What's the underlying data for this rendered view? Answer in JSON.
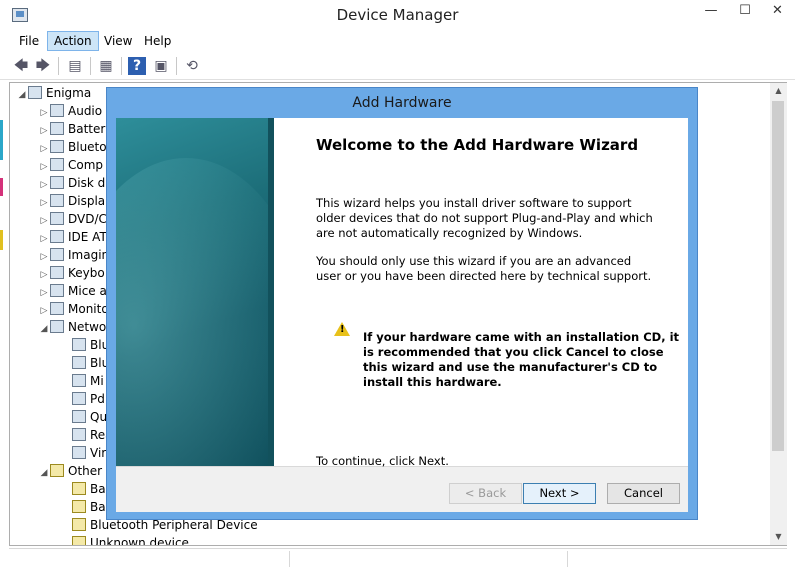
{
  "window": {
    "title": "Device Manager",
    "minimize_glyph": "—",
    "maximize_glyph": "☐",
    "close_glyph": "✕"
  },
  "menu": {
    "items": [
      {
        "label": "File"
      },
      {
        "label": "Action"
      },
      {
        "label": "View"
      },
      {
        "label": "Help"
      }
    ]
  },
  "toolbar": {
    "icons": [
      "back-arrow-icon",
      "forward-arrow-icon",
      "show-hide-console-icon",
      "properties-icon",
      "help-icon",
      "view-icon",
      "scan-hardware-icon"
    ],
    "glyphs": [
      "🡄",
      "🡆",
      "▤",
      "▦",
      "?",
      "▣",
      "⟲"
    ]
  },
  "tree": {
    "arrows": [
      "◢",
      "▷",
      "◢"
    ],
    "root": "Enigma",
    "categories": [
      {
        "label": "Audio"
      },
      {
        "label": "Batteri"
      },
      {
        "label": "Blueto"
      },
      {
        "label": "Comp"
      },
      {
        "label": "Disk dr"
      },
      {
        "label": "Displa"
      },
      {
        "label": "DVD/C"
      },
      {
        "label": "IDE AT"
      },
      {
        "label": "Imagin"
      },
      {
        "label": "Keybo"
      },
      {
        "label": "Mice a"
      },
      {
        "label": "Monito"
      },
      {
        "label": "Netwo"
      }
    ],
    "network_children": [
      {
        "label": "Blu"
      },
      {
        "label": "Blu"
      },
      {
        "label": "Mi"
      },
      {
        "label": "Pd"
      },
      {
        "label": "Qu"
      },
      {
        "label": "Rea"
      },
      {
        "label": "Vir"
      }
    ],
    "other_label": "Other",
    "other_children": [
      {
        "label": "Bas"
      },
      {
        "label": "Bas"
      },
      {
        "label": "Bluetooth Peripheral Device"
      },
      {
        "label": "Unknown device"
      }
    ]
  },
  "scroll": {
    "up": "▲",
    "down": "▼"
  },
  "dialog": {
    "title": "Add Hardware",
    "heading": "Welcome to the Add Hardware Wizard",
    "paragraph1": "This wizard helps you install driver software to support older devices that do not support Plug-and-Play and which are not automatically recognized by Windows.",
    "paragraph2": "You should only use this wizard if you are an advanced user or you have been directed here by technical support.",
    "warning_glyph": "!",
    "warning": "If your hardware came with an installation CD, it is recommended that you click Cancel to close this wizard and use the manufacturer's CD to install this hardware.",
    "continue": "To continue, click Next.",
    "buttons": {
      "back": "< Back",
      "next": "Next >",
      "cancel": "Cancel"
    }
  }
}
